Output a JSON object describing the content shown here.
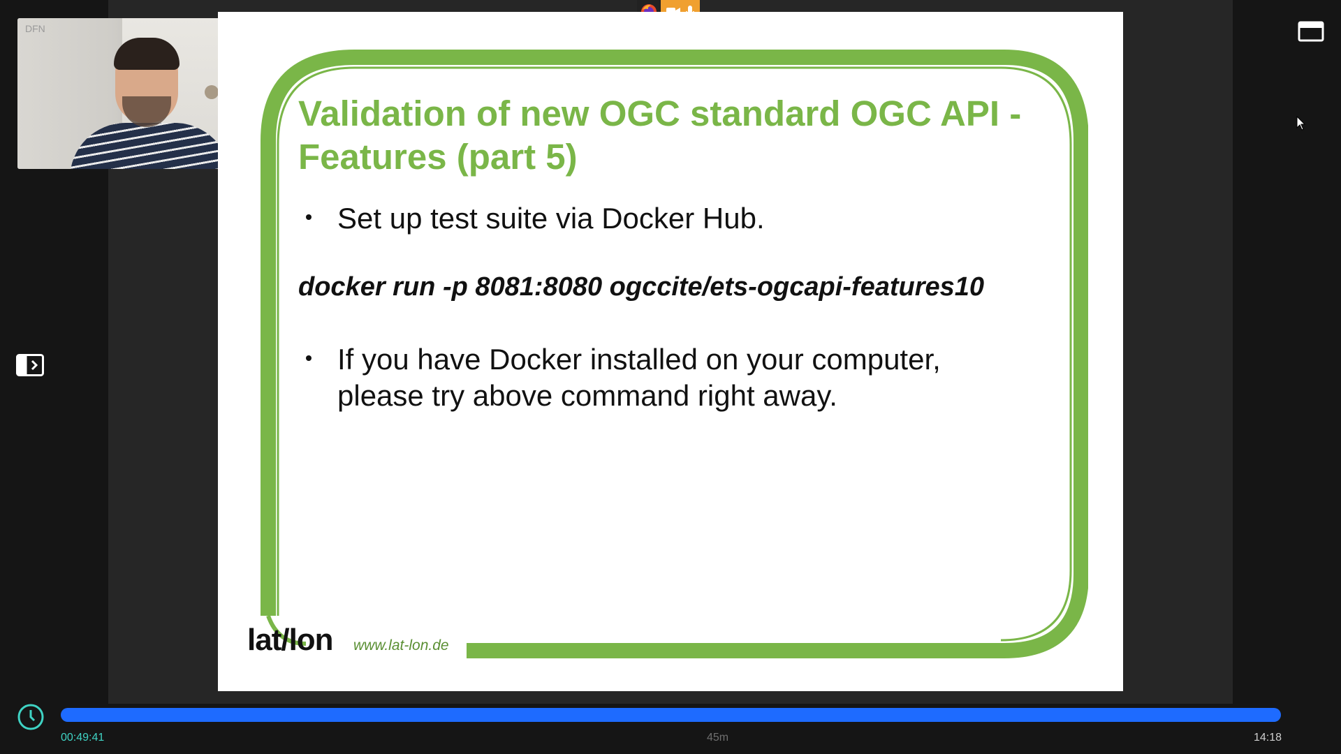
{
  "webcam": {
    "label": "DFN"
  },
  "slide": {
    "title": "Validation of new OGC standard OGC API - Features (part 5)",
    "bullet_1": "Set up test suite via Docker Hub.",
    "command": "docker run -p 8081:8080 ogccite/ets-ogcapi-features10",
    "bullet_2": "If you have Docker installed on your computer, please try above command right away.",
    "logo": "lat/lon",
    "logo_url": "www.lat-lon.de",
    "accent_color": "#7ab648"
  },
  "player": {
    "time_elapsed": "00:49:41",
    "time_mid": "45m",
    "time_clock": "14:18",
    "progress_fraction": 1.0,
    "progress_color": "#1e6bff"
  },
  "icons": {
    "top_controls": [
      "firefox-icon",
      "video-camera-icon",
      "microphone-icon"
    ],
    "pip": "picture-in-picture-icon",
    "sidebar": "sidebar-expand-icon",
    "clock": "clock-icon",
    "cursor": "mouse-cursor-icon"
  }
}
